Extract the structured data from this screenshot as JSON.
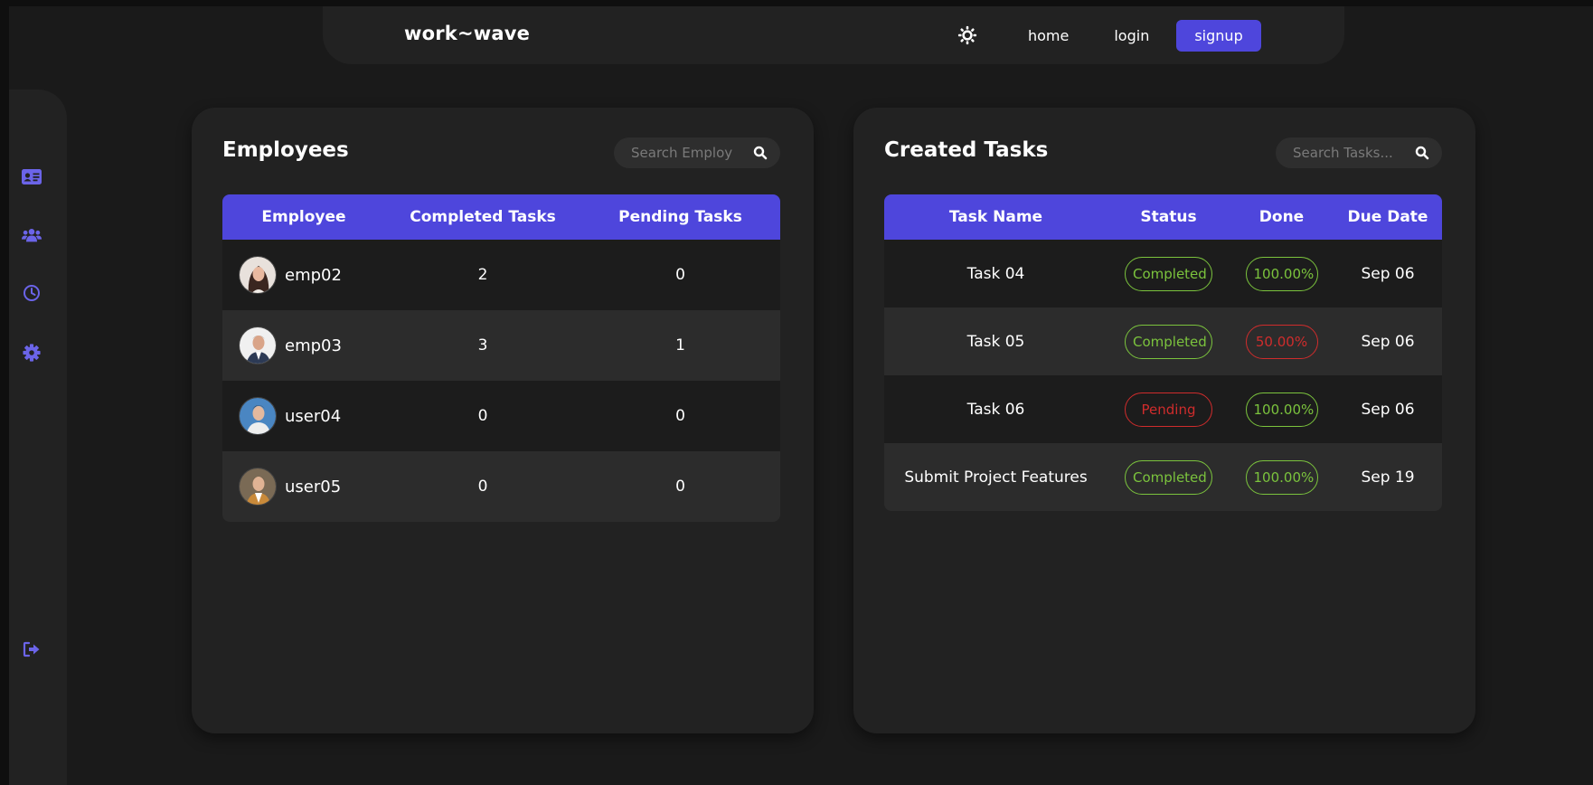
{
  "colors": {
    "accent": "#4e46dc",
    "success": "#7bc33d",
    "danger": "#cf2c2c",
    "panel": "#222222",
    "background": "#1a1a1a"
  },
  "navbar": {
    "brand": "work~wave",
    "theme_icon": "gear-sun-icon",
    "links": [
      {
        "label": "home",
        "active": false
      },
      {
        "label": "login",
        "active": false
      },
      {
        "label": "signup",
        "active": true
      }
    ]
  },
  "sidebar": {
    "items": [
      {
        "icon": "id-card-icon"
      },
      {
        "icon": "users-icon"
      },
      {
        "icon": "clock-icon"
      },
      {
        "icon": "gear-icon"
      }
    ],
    "logout_icon": "logout-icon"
  },
  "employees_panel": {
    "title": "Employees",
    "search_placeholder": "Search Employ",
    "search_icon": "search-icon",
    "columns": [
      "Employee",
      "Completed Tasks",
      "Pending Tasks"
    ],
    "rows": [
      {
        "name": "emp02",
        "completed": "2",
        "pending": "0"
      },
      {
        "name": "emp03",
        "completed": "3",
        "pending": "1"
      },
      {
        "name": "user04",
        "completed": "0",
        "pending": "0"
      },
      {
        "name": "user05",
        "completed": "0",
        "pending": "0"
      }
    ]
  },
  "tasks_panel": {
    "title": "Created Tasks",
    "search_placeholder": "Search Tasks...",
    "search_icon": "search-icon",
    "columns": [
      "Task Name",
      "Status",
      "Done",
      "Due Date"
    ],
    "rows": [
      {
        "task": "Task 04",
        "status": "Completed",
        "status_color": "green",
        "done": "100.00%",
        "done_color": "green",
        "due": "Sep 06"
      },
      {
        "task": "Task 05",
        "status": "Completed",
        "status_color": "green",
        "done": "50.00%",
        "done_color": "red",
        "due": "Sep 06"
      },
      {
        "task": "Task 06",
        "status": "Pending",
        "status_color": "red",
        "done": "100.00%",
        "done_color": "green",
        "due": "Sep 06"
      },
      {
        "task": "Submit Project Features",
        "status": "Completed",
        "status_color": "green",
        "done": "100.00%",
        "done_color": "green",
        "due": "Sep 19"
      }
    ]
  }
}
